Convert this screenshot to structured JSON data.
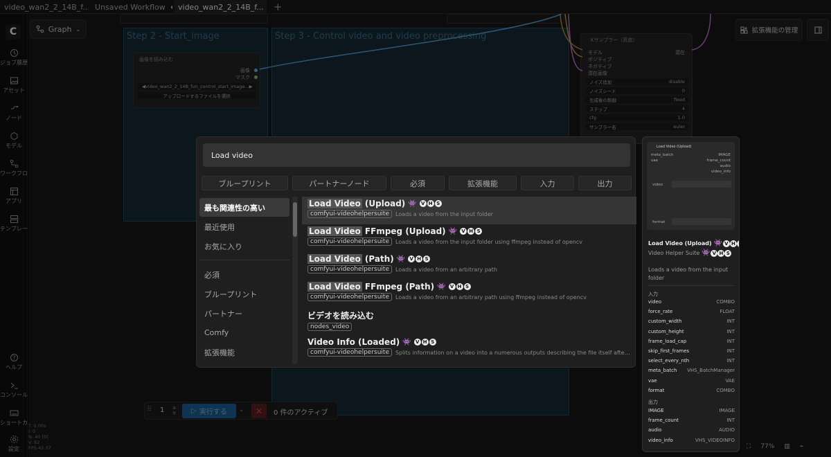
{
  "tabs": [
    {
      "label": "video_wan2_2_14B_f..."
    },
    {
      "label": "Unsaved Workflow"
    },
    {
      "label": "video_wan2_2_14B_f..."
    }
  ],
  "tab_add": "+",
  "sidebar": {
    "items": [
      {
        "label": "ジョブ履歴",
        "icon": "history-icon"
      },
      {
        "label": "アセット",
        "icon": "image-icon"
      },
      {
        "label": "ノード",
        "icon": "node-icon"
      },
      {
        "label": "モデル",
        "icon": "cube-icon"
      },
      {
        "label": "ワークフロー",
        "icon": "workflow-icon"
      },
      {
        "label": "アプリ",
        "icon": "app-icon"
      },
      {
        "label": "テンプレート",
        "icon": "template-icon"
      },
      {
        "label": "ヘルプ",
        "icon": "help-icon"
      },
      {
        "label": "コンソール",
        "icon": "console-icon"
      },
      {
        "label": "ショートカット",
        "icon": "keyboard-icon"
      },
      {
        "label": "設定",
        "icon": "gear-icon"
      }
    ]
  },
  "graph_label": "Graph",
  "top_right": {
    "extensions_label": "拡張機能の管理"
  },
  "canvas": {
    "group_step2": "Step 2 - Start_image",
    "group_step3": "Step 3 - Control video and video preprocessing",
    "load_image_node": {
      "title": "画像を読み込む",
      "outputs": [
        "画像",
        "マスク"
      ],
      "file_value": "video_wan2_2_14B_fun_control_start_image...",
      "upload_label": "アップロードするファイルを選択"
    },
    "ksampler": {
      "title": "Kサンプラー（高度）",
      "inputs": [
        "モデル",
        "ポジティブ",
        "ネガティブ",
        "潜在画像"
      ],
      "output": "潜在",
      "widgets": [
        {
          "label": "ノイズ追加",
          "value": "disable"
        },
        {
          "label": "ノイズシード",
          "value": "0"
        },
        {
          "label": "生成後の制御",
          "value": "fixed"
        },
        {
          "label": "ステップ",
          "value": "4"
        },
        {
          "label": "cfg",
          "value": "1.0"
        },
        {
          "label": "サンプラー名",
          "value": "euler"
        }
      ]
    }
  },
  "dialog": {
    "search_value": "Load video",
    "filter_tabs": [
      "ブループリント",
      "パートナーノード",
      "必須",
      "拡張機能",
      "入力",
      "出力"
    ],
    "categories_top": [
      "最も関連性の高い",
      "最近使用",
      "お気に入り"
    ],
    "categories_bottom": [
      "必須",
      "ブループリント",
      "パートナー",
      "Comfy",
      "拡張機能"
    ],
    "results": [
      {
        "hl": "Load Video",
        "rest": "(Upload)",
        "vhs": true,
        "pill": "comfyui-videohelpersuite",
        "desc": "Loads a video from the input folder"
      },
      {
        "hl": "Load Video",
        "rest": "FFmpeg (Upload)",
        "vhs": true,
        "pill": "comfyui-videohelpersuite",
        "desc": "Loads a video from the input folder using ffmpeg instead of opencv"
      },
      {
        "hl": "Load Video",
        "rest": "(Path)",
        "vhs": true,
        "pill": "comfyui-videohelpersuite",
        "desc": "Loads a video from an arbitrary path"
      },
      {
        "hl": "Load Video",
        "rest": "FFmpeg (Path)",
        "vhs": true,
        "pill": "comfyui-videohelpersuite",
        "desc": "Loads a video from an arbitrary path using ffmpeg instead of opencv"
      },
      {
        "hl": "",
        "rest": "ビデオを読み込む",
        "vhs": false,
        "pill": "nodes_video",
        "desc": ""
      },
      {
        "hl": "",
        "rest": "Video Info (Loaded)",
        "vhs": true,
        "pill": "comfyui-videohelpersuite",
        "desc": "Splits information on a video into a numerous outputs describing the file itself after accounti..."
      }
    ]
  },
  "vhs_letters": [
    "V",
    "H",
    "S"
  ],
  "preview": {
    "node_title": "Load Video (Upload)",
    "node_inputs": [
      "meta_batch",
      "vae"
    ],
    "node_outputs": [
      "IMAGE",
      "frame_count",
      "audio",
      "video_info"
    ],
    "node_widgets": [
      "video",
      "format"
    ],
    "title": "Load Video (Upload)",
    "subtitle": "Video Helper Suite",
    "description": "Loads a video from the input folder",
    "inputs_header": "入力",
    "inputs": [
      {
        "name": "video",
        "type": "COMBO"
      },
      {
        "name": "force_rate",
        "type": "FLOAT"
      },
      {
        "name": "custom_width",
        "type": "INT"
      },
      {
        "name": "custom_height",
        "type": "INT"
      },
      {
        "name": "frame_load_cap",
        "type": "INT"
      },
      {
        "name": "skip_first_frames",
        "type": "INT"
      },
      {
        "name": "select_every_nth",
        "type": "INT"
      },
      {
        "name": "meta_batch",
        "type": "VHS_BatchManager"
      },
      {
        "name": "vae",
        "type": "VAE"
      },
      {
        "name": "format",
        "type": "COMBO"
      }
    ],
    "outputs_header": "出力",
    "outputs": [
      {
        "name": "IMAGE",
        "type": "IMAGE"
      },
      {
        "name": "frame_count",
        "type": "INT"
      },
      {
        "name": "audio",
        "type": "AUDIO"
      },
      {
        "name": "video_info",
        "type": "VHS_VIDEOINFO"
      }
    ]
  },
  "runbar": {
    "count": "1",
    "run_label": "実行する",
    "active_label": "0 件のアクティブ"
  },
  "stats": [
    "T: 0.00s",
    "I: 0",
    "N: 40 [0]",
    "V: 82",
    "FPS:42.37"
  ],
  "zoom": "77%"
}
